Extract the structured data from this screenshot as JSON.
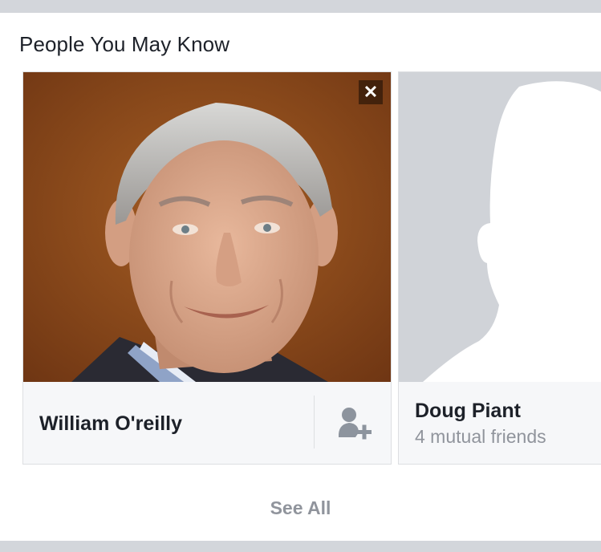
{
  "section": {
    "title": "People You May Know",
    "see_all_label": "See All"
  },
  "people": [
    {
      "name": "William O'reilly",
      "close_glyph": "✕",
      "action_icon": "add-friend-icon"
    },
    {
      "name": "Doug Piant",
      "mutual": "4 mutual friends",
      "photo": "default-silhouette"
    }
  ],
  "colors": {
    "page_bg": "#d3d6db",
    "card_bg": "#f6f7f9",
    "text_primary": "#1d2129",
    "text_secondary": "#90949c",
    "placeholder_bg": "#d0d3d8"
  }
}
